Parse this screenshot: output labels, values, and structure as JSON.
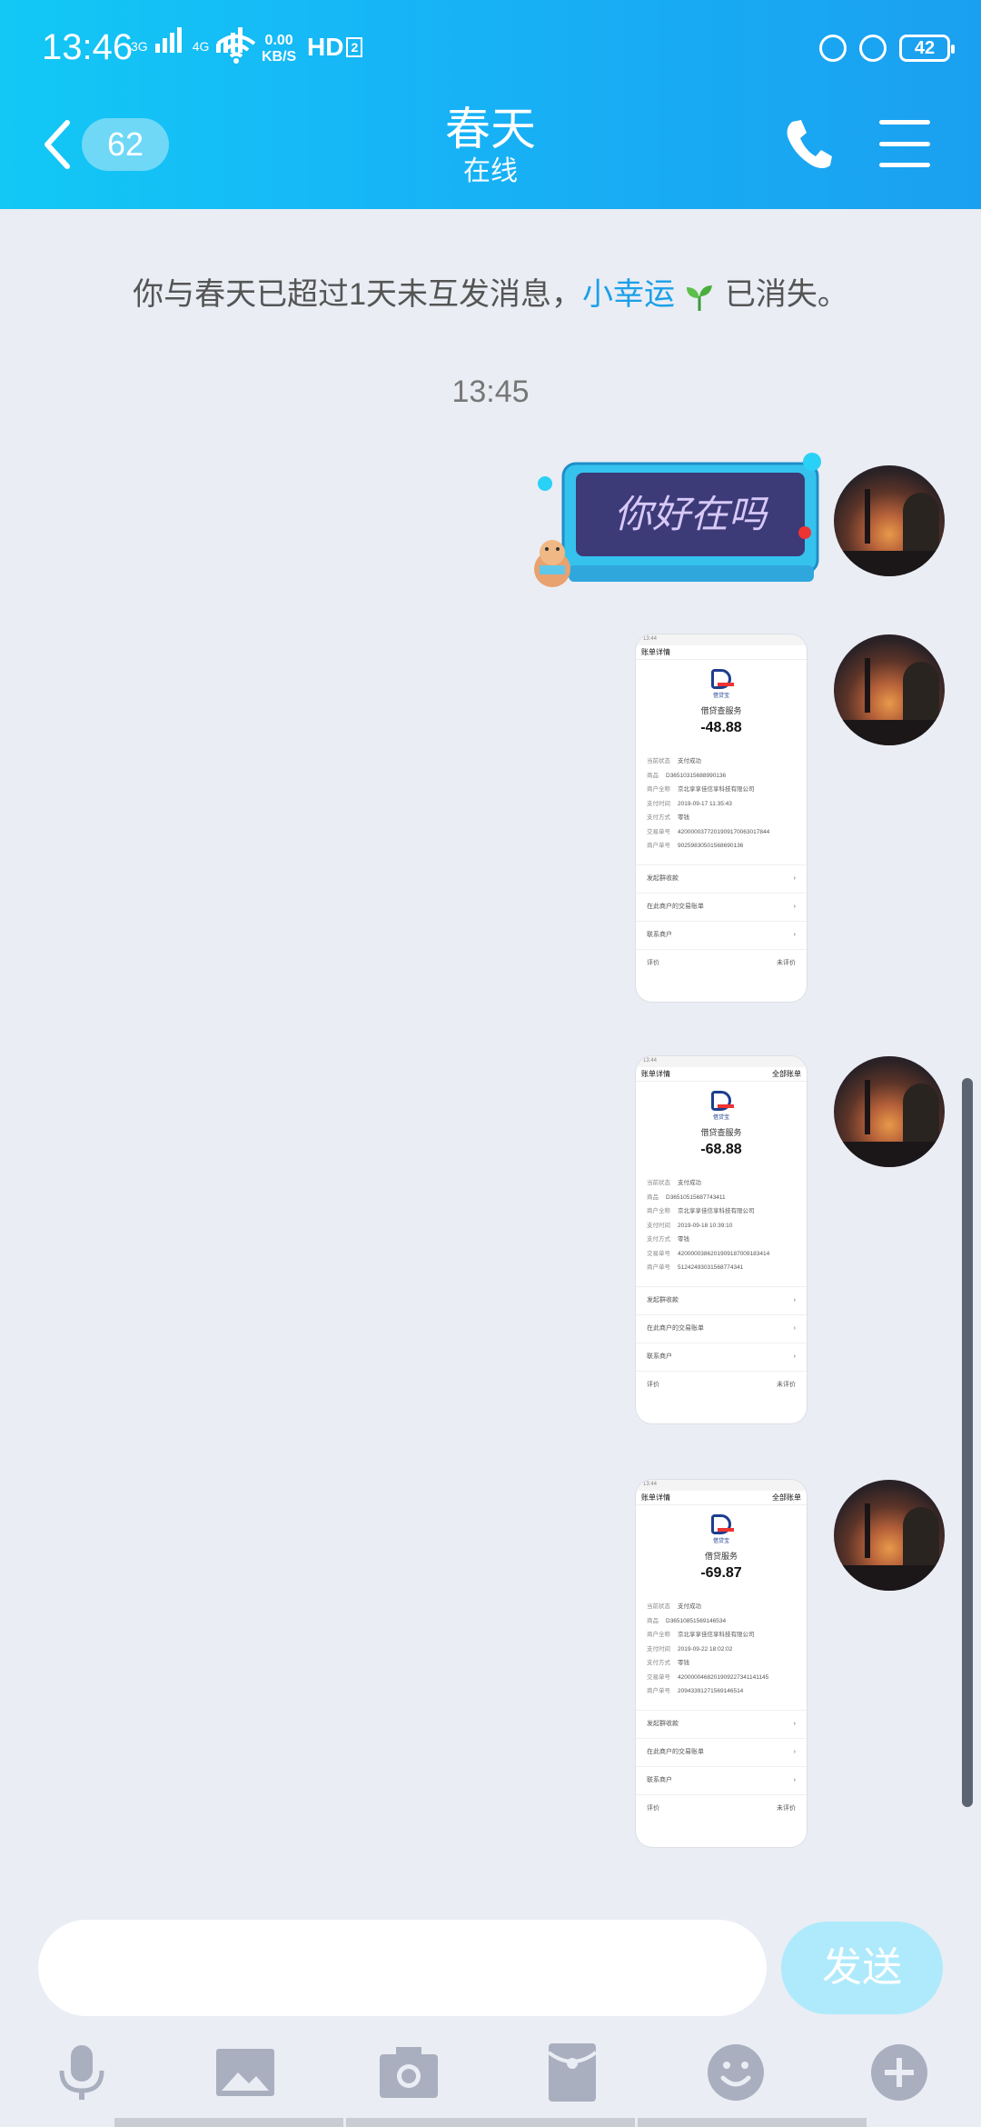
{
  "status_bar": {
    "time": "13:46",
    "net1": "3G",
    "net2": "4G",
    "speed_value": "0.00",
    "speed_unit": "KB/S",
    "hd_label": "HD",
    "hd_num": "2",
    "battery": "42"
  },
  "header": {
    "unread_count": "62",
    "title": "春天",
    "subtitle": "在线"
  },
  "notice": {
    "prefix": "你与春天已超过1天未互发消息，",
    "link": "小幸运",
    "suffix": "已消失。"
  },
  "timestamp": "13:45",
  "sticker": {
    "text": "你好在吗"
  },
  "receipts": [
    {
      "time": "13:44",
      "header_title": "账单详情",
      "header_right": "",
      "brand": "借贷宝",
      "merchant": "借贷查服务",
      "amount": "-48.88",
      "rows": [
        [
          "当前状态",
          "支付成功"
        ],
        [
          "商品",
          "D36510315688990136"
        ],
        [
          "商户全称",
          "京北享享佳信享科技有限公司"
        ],
        [
          "支付时间",
          "2019-09-17 11:35:43"
        ],
        [
          "支付方式",
          "零钱"
        ],
        [
          "交易单号",
          "4200000377201909170063017844"
        ],
        [
          "商户单号",
          "90259830501568690136"
        ]
      ],
      "links": [
        "发起群收款",
        "在此商户的交易账单",
        "联系商户",
        "评价"
      ],
      "rate_text": "未评价"
    },
    {
      "time": "13:44",
      "header_title": "账单详情",
      "header_right": "全部账单",
      "brand": "借贷宝",
      "merchant": "借贷查服务",
      "amount": "-68.88",
      "rows": [
        [
          "当前状态",
          "支付成功"
        ],
        [
          "商品",
          "D36510515687743411"
        ],
        [
          "商户全称",
          "京北享享佳信享科技有限公司"
        ],
        [
          "支付时间",
          "2019-09-18 10:39:10"
        ],
        [
          "支付方式",
          "零钱"
        ],
        [
          "交易单号",
          "4200000386201909187009183414"
        ],
        [
          "商户单号",
          "51242493031568774341"
        ]
      ],
      "links": [
        "发起群收款",
        "在此商户的交易账单",
        "联系商户",
        "评价"
      ],
      "rate_text": "未评价"
    },
    {
      "time": "13:44",
      "header_title": "账单详情",
      "header_right": "全部账单",
      "brand": "借贷宝",
      "merchant": "借贷服务",
      "amount": "-69.87",
      "rows": [
        [
          "当前状态",
          "支付成功"
        ],
        [
          "商品",
          "D36510851569146534"
        ],
        [
          "商户全称",
          "京北享享佳信享科技有限公司"
        ],
        [
          "支付时间",
          "2019-09-22 18:02:02"
        ],
        [
          "支付方式",
          "零钱"
        ],
        [
          "交易单号",
          "4200000468201909227341141145"
        ],
        [
          "商户单号",
          "20943391271569146514"
        ]
      ],
      "links": [
        "发起群收款",
        "在此商户的交易账单",
        "联系商户",
        "评价"
      ],
      "rate_text": "未评价"
    }
  ],
  "composer": {
    "input_value": "",
    "send_label": "发送"
  },
  "toolbar_icons": [
    "microphone-icon",
    "image-icon",
    "camera-icon",
    "red-packet-icon",
    "emoji-icon",
    "plus-icon"
  ],
  "colors": {
    "header_start": "#12c8f5",
    "header_end": "#1aa0f0",
    "background": "#eaedf4",
    "link": "#1aa0e8",
    "send_button": "#aeeafc",
    "toolbar_icon": "#a9afbe"
  }
}
